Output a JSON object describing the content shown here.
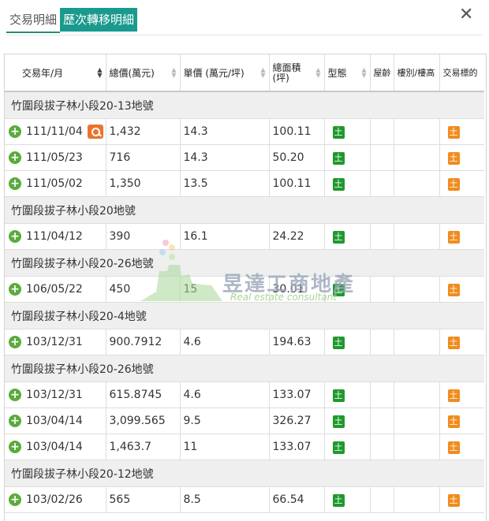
{
  "tabs": [
    "交易明細",
    "歷次轉移明細"
  ],
  "close_label": "✕",
  "columns": [
    "交易年/月",
    "總價(萬元)",
    "單價 (萬元/坪)",
    "總面積\n(坪)",
    "型態",
    "屋齡",
    "樓別/樓高",
    "交易標的"
  ],
  "type_badge": "土",
  "target_badge": "土",
  "watermark": {
    "name": "昱達工商地產",
    "sub": "Real estate consultant"
  },
  "groups": [
    {
      "title": "竹圍段拔子林小段20-13地號",
      "rows": [
        {
          "date": "111/11/04",
          "total": "1,432",
          "unit": "14.3",
          "area": "100.11",
          "house": true
        },
        {
          "date": "111/05/23",
          "total": "716",
          "unit": "14.3",
          "area": "50.20"
        },
        {
          "date": "111/05/02",
          "total": "1,350",
          "unit": "13.5",
          "area": "100.11"
        }
      ]
    },
    {
      "title": "竹圍段拔子林小段20地號",
      "rows": [
        {
          "date": "111/04/12",
          "total": "390",
          "unit": "16.1",
          "area": "24.22"
        }
      ]
    },
    {
      "title": "竹圍段拔子林小段20-26地號",
      "rows": [
        {
          "date": "106/05/22",
          "total": "450",
          "unit": "15",
          "area": "30.01"
        }
      ]
    },
    {
      "title": "竹圍段拔子林小段20-4地號",
      "rows": [
        {
          "date": "103/12/31",
          "total": "900.7912",
          "unit": "4.6",
          "area": "194.63"
        }
      ]
    },
    {
      "title": "竹圍段拔子林小段20-26地號",
      "rows": [
        {
          "date": "103/12/31",
          "total": "615.8745",
          "unit": "4.6",
          "area": "133.07"
        },
        {
          "date": "103/04/14",
          "total": "3,099.565",
          "unit": "9.5",
          "area": "326.27"
        },
        {
          "date": "103/04/14",
          "total": "1,463.7",
          "unit": "11",
          "area": "133.07"
        }
      ]
    },
    {
      "title": "竹圍段拔子林小段20-12地號",
      "rows": [
        {
          "date": "103/02/26",
          "total": "565",
          "unit": "8.5",
          "area": "66.54"
        }
      ]
    }
  ],
  "colors": {
    "accent": "#1a9a8e",
    "plus": "#5aab3c",
    "type_badge": "#1e9a2c",
    "target_badge": "#f08c1e"
  }
}
